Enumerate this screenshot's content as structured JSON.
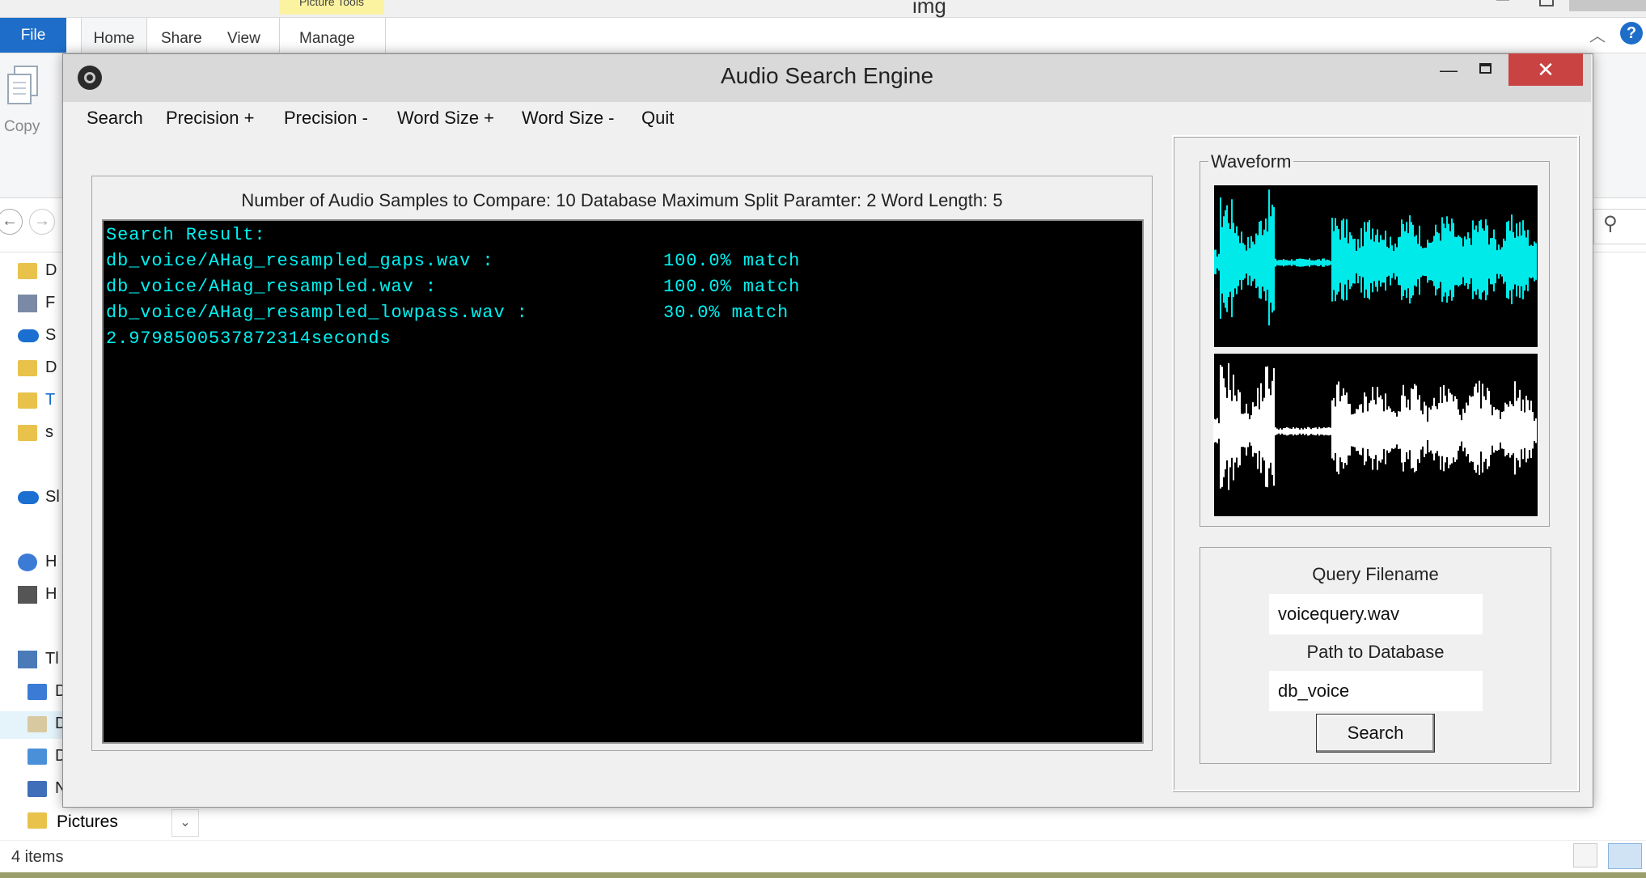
{
  "explorer": {
    "window_title": "img",
    "contextual_tab": "Picture Tools",
    "tabs": [
      "File",
      "Home",
      "Share",
      "View",
      "Manage"
    ],
    "ribbon": {
      "copy_label": "Copy"
    },
    "nav_items": [
      "D",
      "F",
      "S",
      "D",
      "T",
      "s",
      "Sl",
      "H",
      "H",
      "Tl",
      "D",
      "D",
      "D",
      "N"
    ],
    "pictures_label": "Pictures",
    "status_text": "4 items",
    "help_glyph": "?"
  },
  "app": {
    "title": "Audio Search Engine",
    "window_controls": {
      "minimize": "—",
      "close": "✕"
    },
    "menu": [
      "Search",
      "Precision +",
      "Precision -",
      "Word Size +",
      "Word Size -",
      "Quit"
    ],
    "params_text": "Number of Audio Samples to Compare: 10 Database Maximum Split Paramter: 2 Word Length: 5",
    "console": {
      "header": "Search Result:",
      "results": [
        {
          "file": "db_voice/AHag_resampled_gaps.wav :",
          "score": "100.0% match"
        },
        {
          "file": "db_voice/AHag_resampled.wav :",
          "score": "100.0% match"
        },
        {
          "file": "db_voice/AHag_resampled_lowpass.wav :",
          "score": "30.0% match"
        }
      ],
      "elapsed": "2.9798500537872314seconds",
      "text_color": "#00f2f2"
    },
    "waveform": {
      "label": "Waveform",
      "top_color": "#00eaea",
      "bottom_color": "#ffffff"
    },
    "query": {
      "filename_label": "Query Filename",
      "filename_value": "voicequery.wav",
      "db_label": "Path to Database",
      "db_value": "db_voice",
      "search_button": "Search"
    }
  }
}
